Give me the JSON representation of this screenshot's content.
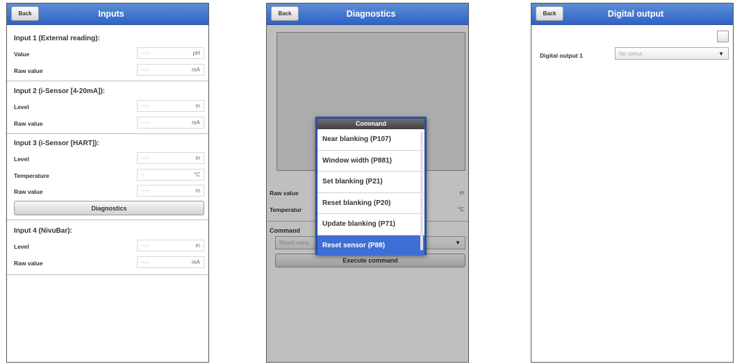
{
  "inputs_screen": {
    "header": {
      "back_label": "Back",
      "title": "Inputs"
    },
    "sections": [
      {
        "title": "Input 1 (External reading):",
        "rows": [
          {
            "label": "Value",
            "value": "--:--",
            "unit": "pH"
          },
          {
            "label": "Raw value",
            "value": "--:--",
            "unit": "mA"
          }
        ]
      },
      {
        "title": "Input 2 (i-Sensor [4-20mA]):",
        "rows": [
          {
            "label": "Level",
            "value": "--:--",
            "unit": "m"
          },
          {
            "label": "Raw value",
            "value": "--:--",
            "unit": "mA"
          }
        ]
      },
      {
        "title": "Input 3 (i-Sensor [HART]):",
        "rows": [
          {
            "label": "Level",
            "value": "--:--",
            "unit": "m"
          },
          {
            "label": "Temperature",
            "value": "--",
            "unit": "°C"
          },
          {
            "label": "Raw value",
            "value": "--:--",
            "unit": "m"
          }
        ]
      },
      {
        "title": "Input 4 (NivuBar):",
        "rows": [
          {
            "label": "Level",
            "value": "--:--",
            "unit": "m"
          },
          {
            "label": "Raw value",
            "value": "--:--",
            "unit": "mA"
          }
        ]
      }
    ],
    "diagnostics_button": "Diagnostics"
  },
  "diagnostics_screen": {
    "header": {
      "back_label": "Back",
      "title": "Diagnostics"
    },
    "raw_value_label": "Raw value",
    "raw_value_unit": "m",
    "temperature_label": "Temperatur",
    "temperature_unit": "°C",
    "command_label": "Command",
    "command_select_value": "Reset sens",
    "execute_button": "Execute command",
    "dialog": {
      "title": "Command",
      "options": [
        "Near blanking (P107)",
        "Window width (P881)",
        "Set blanking (P21)",
        "Reset blanking (P20)",
        "Update blanking (P71)",
        "Reset sensor (P88)"
      ],
      "selected_index": 5
    }
  },
  "digital_output_screen": {
    "header": {
      "back_label": "Back",
      "title": "Digital output"
    },
    "row_label": "Digital output 1",
    "select_value": "No simul.",
    "checkbox_checked": false
  },
  "colors": {
    "header_blue": "#3a6fd0",
    "selection_blue": "#3e6fd6",
    "dialog_border": "#2c4fa0"
  }
}
